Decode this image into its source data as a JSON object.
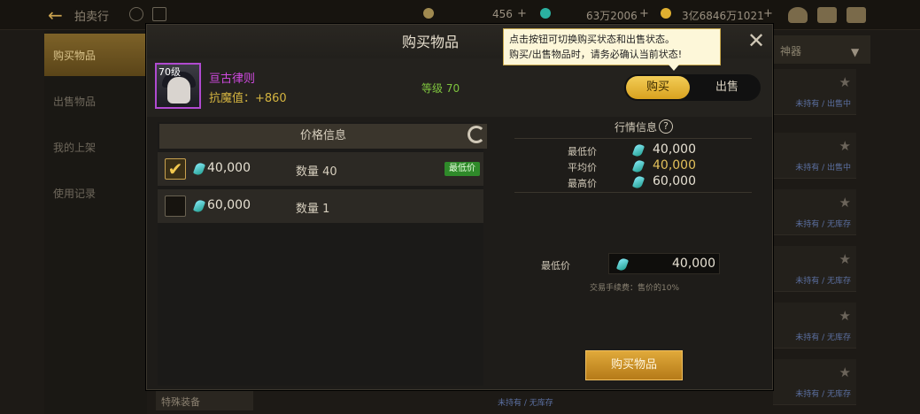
{
  "topbar": {
    "title": "拍卖行",
    "currency_1": "456",
    "currency_2": "63万2006",
    "currency_3": "3亿6846万1021"
  },
  "sidebar": {
    "items": [
      {
        "label": "购买物品"
      },
      {
        "label": "出售物品"
      },
      {
        "label": "我的上架"
      },
      {
        "label": "使用记录"
      }
    ]
  },
  "right_list": {
    "dropdown": "神器",
    "rows": [
      {
        "tag": "未持有 / 出售中"
      },
      {
        "tag": "未持有 / 出售中"
      },
      {
        "tag": "未持有 / 无库存"
      },
      {
        "tag": "未持有 / 无库存"
      },
      {
        "tag": "未持有 / 无库存"
      },
      {
        "tag": "未持有 / 无库存"
      },
      {
        "tag": "未持有 / 无库存"
      }
    ]
  },
  "bottom": {
    "dropdown": "特殊装备",
    "tag": "未持有 / 无库存"
  },
  "modal": {
    "title": "购买物品",
    "tooltip_line1": "点击按钮可切换购买状态和出售状态。",
    "tooltip_line2": "购买/出售物品时，请务必确认当前状态!",
    "item": {
      "level_badge": "70级",
      "name": "亘古律则",
      "stat": "抗魔值：+860",
      "level": "等级 70"
    },
    "toggle": {
      "buy": "购买",
      "sell": "出售"
    },
    "price_panel": {
      "header": "价格信息",
      "offers": [
        {
          "price": "40,000",
          "qty": "数量 40",
          "tag": "最低价",
          "checked": true
        },
        {
          "price": "60,000",
          "qty": "数量 1",
          "tag": "",
          "checked": false
        }
      ]
    },
    "market": {
      "title": "行情信息",
      "help": "?",
      "rows": [
        {
          "label": "最低价",
          "value": "40,000"
        },
        {
          "label": "平均价",
          "value": "40,000"
        },
        {
          "label": "最高价",
          "value": "60,000"
        }
      ]
    },
    "min_price": {
      "label": "最低价",
      "value": "40,000"
    },
    "fee_note": "交易手续费：售价的10%",
    "buy_button": "购买物品",
    "close": "✕",
    "checkmark": "✔"
  }
}
